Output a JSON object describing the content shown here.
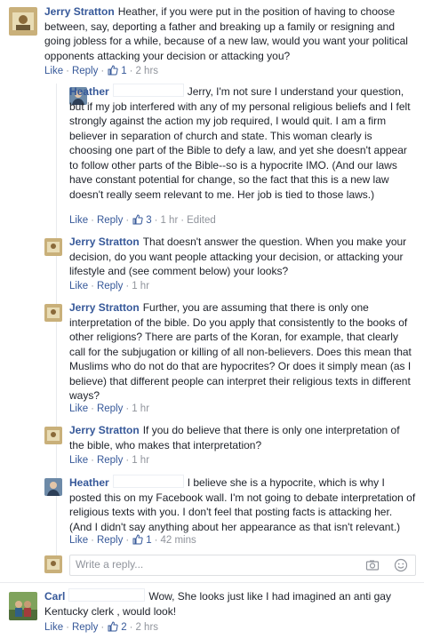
{
  "comments": [
    {
      "author": "Jerry Stratton",
      "text": "Heather, if you were put in the position of having to choose between, say, deporting a father and breaking up a family or resigning and going jobless for a while, because of a new law, would you want your political opponents attacking your decision or attacking you?",
      "like": "Like",
      "reply": "Reply",
      "likes": "1",
      "time": "2 hrs"
    },
    {
      "author": "Heather",
      "text": "Jerry, I'm not sure I understand your question, but if my job interfered with any of my personal religious beliefs and I felt strongly against the action my job required, I would quit. I am a firm believer in separation of church and state. This woman clearly is choosing one part of the Bible to defy a law, and yet she doesn't appear to follow other parts of the Bible--so is a hypocrite IMO. (And our laws have constant potential for change, so the fact that this is a new law doesn't really seem relevant to me. Her job is tied to those laws.)",
      "like": "Like",
      "reply": "Reply",
      "likes": "3",
      "time": "1 hr",
      "edited": "Edited"
    },
    {
      "author": "Jerry Stratton",
      "text": "That doesn't answer the question. When you make your decision, do you want people attacking your decision, or attacking your lifestyle and (see comment below) your looks?",
      "like": "Like",
      "reply": "Reply",
      "time": "1 hr"
    },
    {
      "author": "Jerry Stratton",
      "text": "Further, you are assuming that there is only one interpretation of the bible. Do you apply that consistently to the books of other religions? There are parts of the Koran, for example, that clearly call for the subjugation or killing of all non-believers. Does this mean that Muslims who do not do that are hypocrites? Or does it simply mean (as I believe) that different people can interpret their religious texts in different ways?",
      "like": "Like",
      "reply": "Reply",
      "time": "1 hr"
    },
    {
      "author": "Jerry Stratton",
      "text": "If you do believe that there is only one interpretation of the bible, who makes that interpretation?",
      "like": "Like",
      "reply": "Reply",
      "time": "1 hr"
    },
    {
      "author": "Heather",
      "text": "I believe she is a hypocrite, which is why I posted this on my Facebook wall. I'm not going to debate interpretation of religious texts with you. I don't feel that posting facts is attacking her. (And I didn't say anything about her appearance as that isn't relevant.)",
      "like": "Like",
      "reply": "Reply",
      "likes": "1",
      "time": "42 mins"
    },
    {
      "author": "Carl",
      "text": "Wow, She looks just like I had imagined an anti gay Kentucky clerk , would look!",
      "like": "Like",
      "reply": "Reply",
      "likes": "2",
      "time": "2 hrs"
    }
  ],
  "reply_box": {
    "placeholder": "Write a reply...",
    "camera_icon": "camera-icon",
    "emoji_icon": "smiley-icon"
  },
  "colors": {
    "link": "#365899",
    "meta": "#90949c",
    "text": "#1d2129",
    "border": "#dddfe2"
  }
}
